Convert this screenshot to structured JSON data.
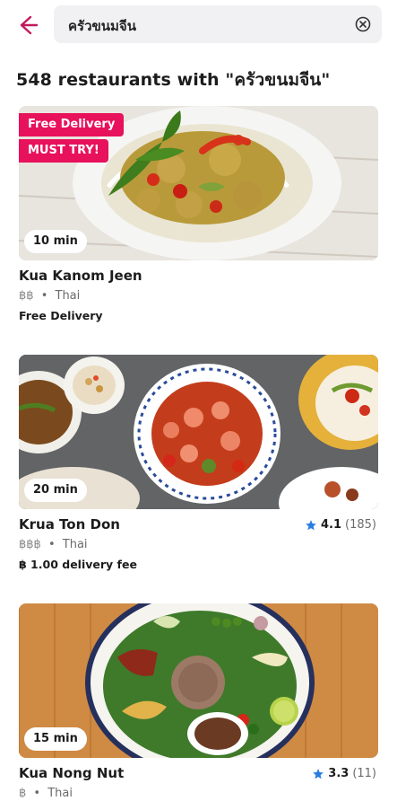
{
  "colors": {
    "brand": "#e8115b",
    "star": "#2a7de1",
    "backArrow": "#c2185b"
  },
  "header": {
    "back_icon": "arrow-left-icon",
    "search_value": "ครัวขนมจีน",
    "clear_icon": "circle-x-icon"
  },
  "results_title": "548 restaurants with \"ครัวขนมจีน\"",
  "restaurants": [
    {
      "tags": [
        "Free Delivery",
        "MUST TRY!"
      ],
      "eta": "10 min",
      "name": "Kua Kanom Jeen",
      "price": "฿฿",
      "cuisine": "Thai",
      "fee": "Free Delivery"
    },
    {
      "eta": "20 min",
      "name": "Krua Ton Don",
      "price": "฿฿฿",
      "cuisine": "Thai",
      "rating": "4.1",
      "reviews": "(185)",
      "fee": "฿ 1.00 delivery fee"
    },
    {
      "eta": "15 min",
      "name": "Kua Nong Nut",
      "price": "฿",
      "cuisine": "Thai",
      "rating": "3.3",
      "reviews": "(11)"
    }
  ],
  "separator": "•"
}
